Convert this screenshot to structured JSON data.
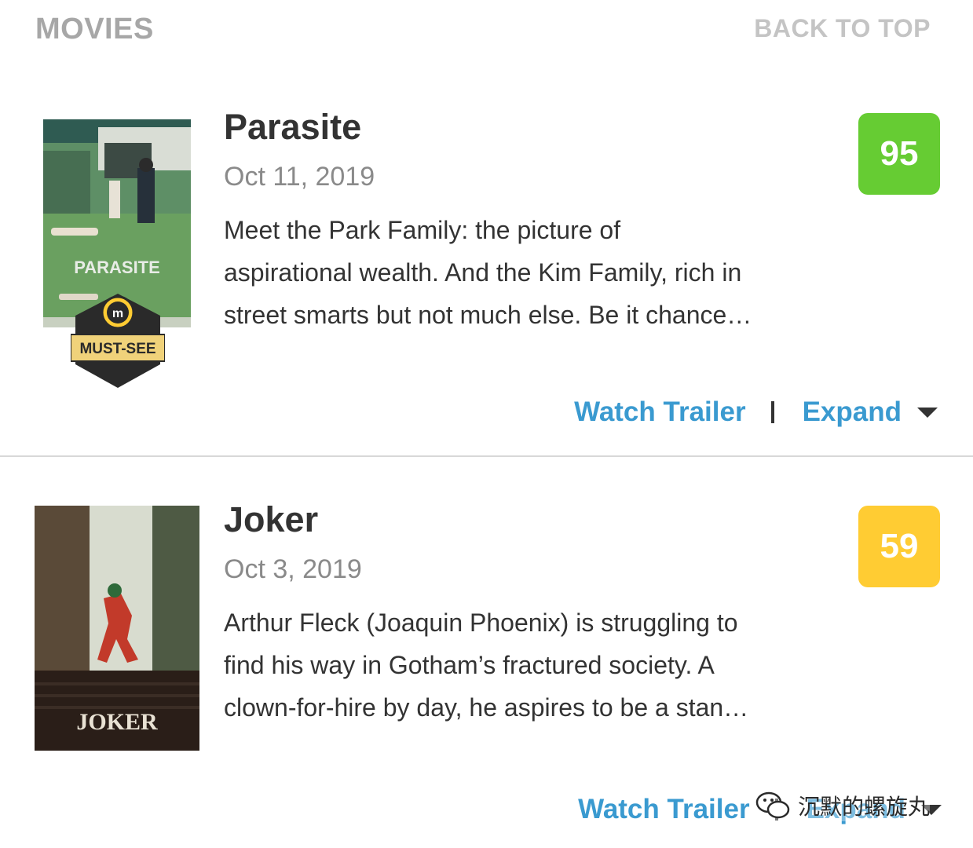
{
  "header": {
    "section_title": "MOVIES",
    "back_to_top": "BACK TO TOP"
  },
  "movies": [
    {
      "title": "Parasite",
      "date": "Oct 11, 2019",
      "summary_lines": [
        "Meet the Park Family: the picture of",
        "aspirational wealth. And the Kim Family, rich in",
        "street smarts but not much else. Be it chance…"
      ],
      "score": "95",
      "score_color": "#66cc33",
      "poster": {
        "title_text": "PARASITE",
        "badge_text": "MUST-SEE",
        "badge_icon": "metacritic-m-icon"
      },
      "watch_trailer": "Watch Trailer",
      "expand": "Expand"
    },
    {
      "title": "Joker",
      "date": "Oct 3, 2019",
      "summary_lines": [
        "Arthur Fleck (Joaquin Phoenix) is struggling to",
        "find his way in Gotham’s fractured society. A",
        "clown-for-hire by day, he aspires to be a stan…"
      ],
      "score": "59",
      "score_color": "#ffcc33",
      "poster": {
        "title_text": "JOKER"
      },
      "watch_trailer": "Watch Trailer",
      "expand": "Expand"
    }
  ],
  "watermark": {
    "text": "沉默的螺旋丸"
  },
  "colors": {
    "link": "#3a9ad0",
    "title": "#333333",
    "muted": "#8a8a8a"
  }
}
